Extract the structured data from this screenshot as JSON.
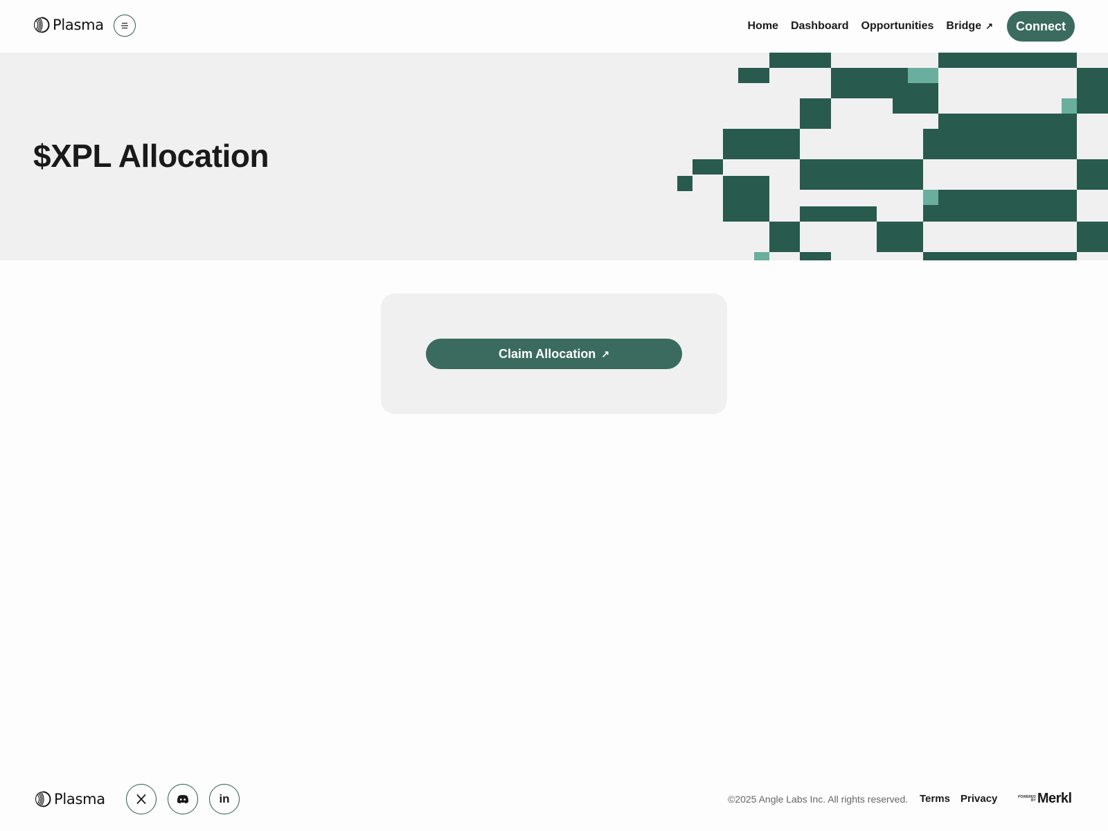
{
  "header": {
    "brand": "Plasma",
    "nav": [
      {
        "label": "Home"
      },
      {
        "label": "Dashboard"
      },
      {
        "label": "Opportunities"
      },
      {
        "label": "Bridge",
        "arrow": "↗"
      }
    ],
    "connect_label": "Connect"
  },
  "hero": {
    "title": "$XPL Allocation"
  },
  "card": {
    "claim_label": "Claim Allocation",
    "claim_arrow": "↗"
  },
  "footer": {
    "brand": "Plasma",
    "socials": [
      "x-icon",
      "discord-icon",
      "linkedin-icon"
    ],
    "linkedin_text": "in",
    "copyright": "©2025 Angle Labs Inc. All rights reserved.",
    "terms_label": "Terms",
    "privacy_label": "Privacy",
    "powered_line1": "POWERED",
    "powered_line2": "BY",
    "merkl_label": "Merkl"
  },
  "colors": {
    "accent": "#3a6b5e",
    "pattern_dark": "#285a4e",
    "pattern_light": "#6aaf9e",
    "hero_bg": "#f0f0f0"
  }
}
